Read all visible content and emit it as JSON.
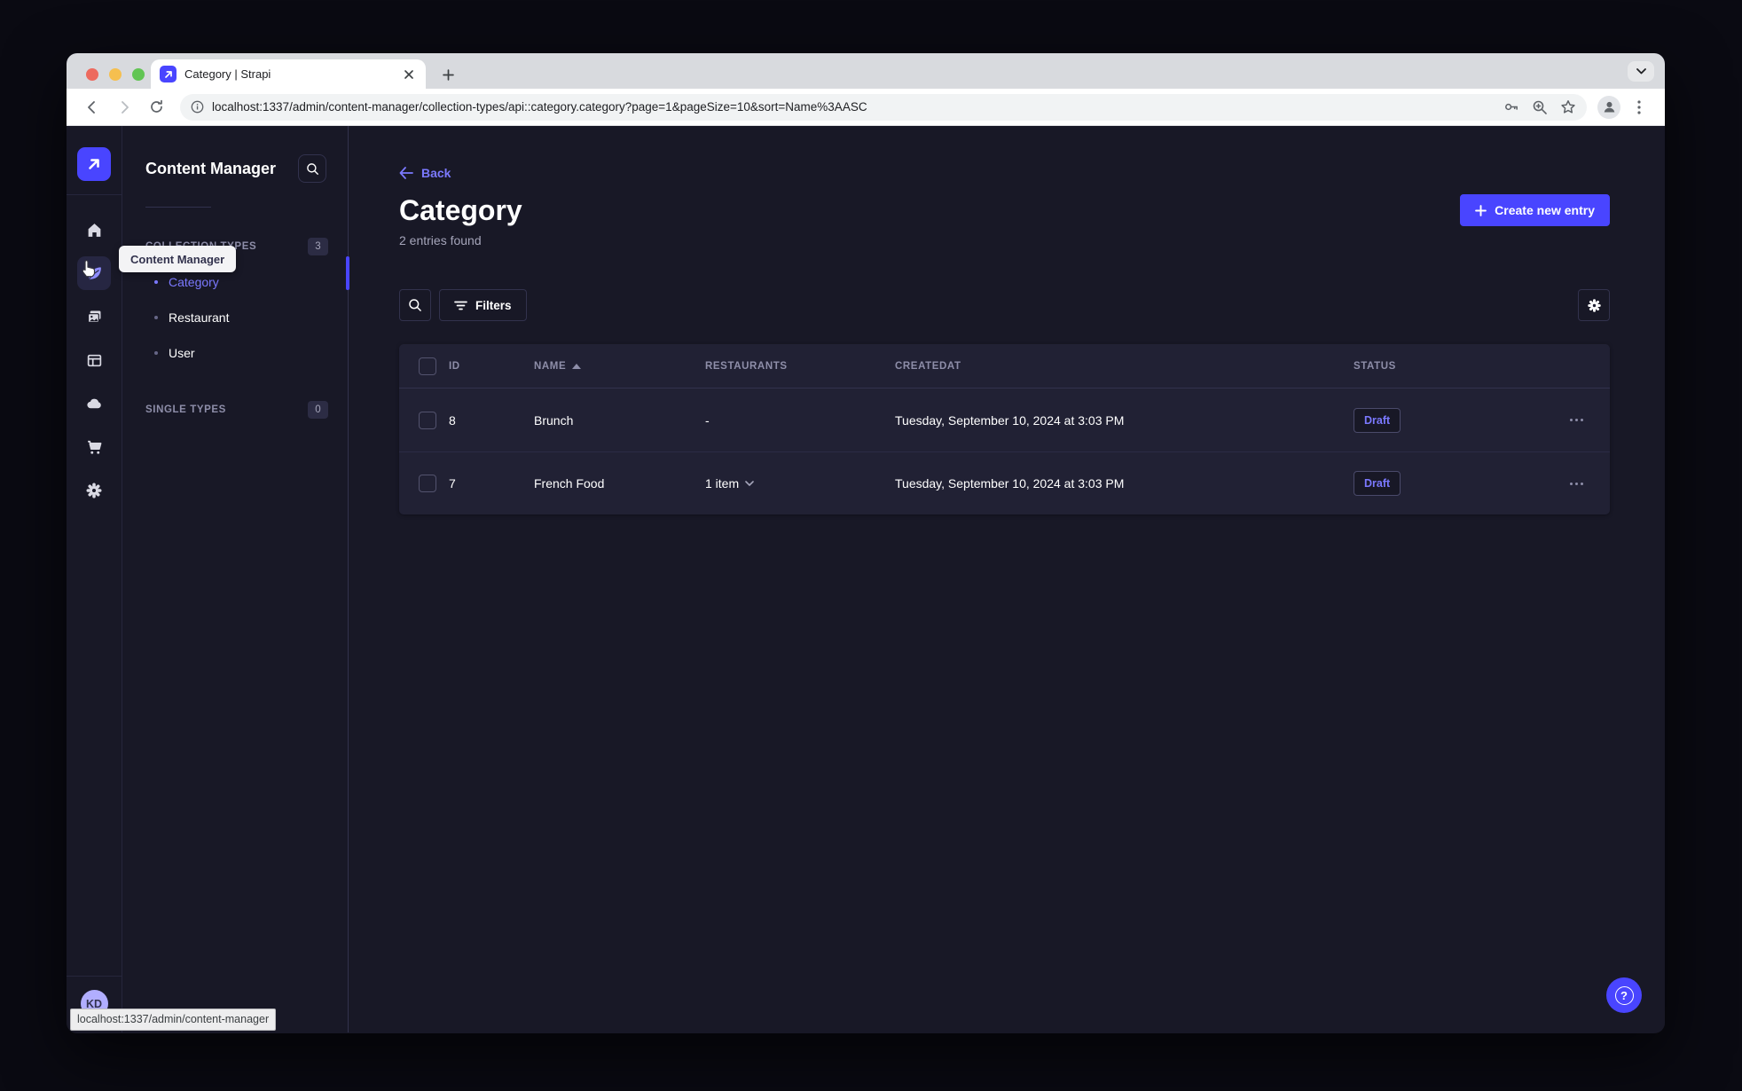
{
  "colors": {
    "primary": "#4945ff",
    "primary_text": "#7b79ff",
    "app_bg": "#181826",
    "card_bg": "#212134",
    "border": "#32324d",
    "muted_text": "#a5a5ba",
    "header_text": "#8e8ea9",
    "traffic_red": "#ed6a5e",
    "traffic_yellow": "#f5bf4f",
    "traffic_green": "#62c554"
  },
  "browser": {
    "tab_title": "Category | Strapi",
    "url": "localhost:1337/admin/content-manager/collection-types/api::category.category?page=1&pageSize=10&sort=Name%3AASC",
    "status_bar_url": "localhost:1337/admin/content-manager"
  },
  "sidebar": {
    "tooltip": "Content Manager",
    "icons": [
      "home",
      "content-manager",
      "media-library",
      "content-type-builder",
      "deploy",
      "marketplace",
      "settings"
    ],
    "user_initials": "KD"
  },
  "subnav": {
    "title": "Content Manager",
    "sections": [
      {
        "label": "COLLECTION TYPES",
        "badge": "3",
        "items": [
          {
            "label": "Category",
            "active": true
          },
          {
            "label": "Restaurant",
            "active": false
          },
          {
            "label": "User",
            "active": false
          }
        ]
      },
      {
        "label": "SINGLE TYPES",
        "badge": "0",
        "items": []
      }
    ]
  },
  "main": {
    "back_label": "Back",
    "title": "Category",
    "subtitle": "2 entries found",
    "create_button_label": "Create new entry",
    "filters_button_label": "Filters",
    "table": {
      "columns": [
        "ID",
        "NAME",
        "RESTAURANTS",
        "CREATEDAT",
        "STATUS"
      ],
      "sorted_column": "NAME",
      "sort_direction": "ascending",
      "rows": [
        {
          "id": "8",
          "name": "Brunch",
          "restaurants": "-",
          "created_at": "Tuesday, September 10, 2024 at 3:03 PM",
          "status": "Draft"
        },
        {
          "id": "7",
          "name": "French Food",
          "restaurants": "1 item",
          "created_at": "Tuesday, September 10, 2024 at 3:03 PM",
          "status": "Draft"
        }
      ]
    }
  },
  "help": {
    "glyph": "?"
  }
}
